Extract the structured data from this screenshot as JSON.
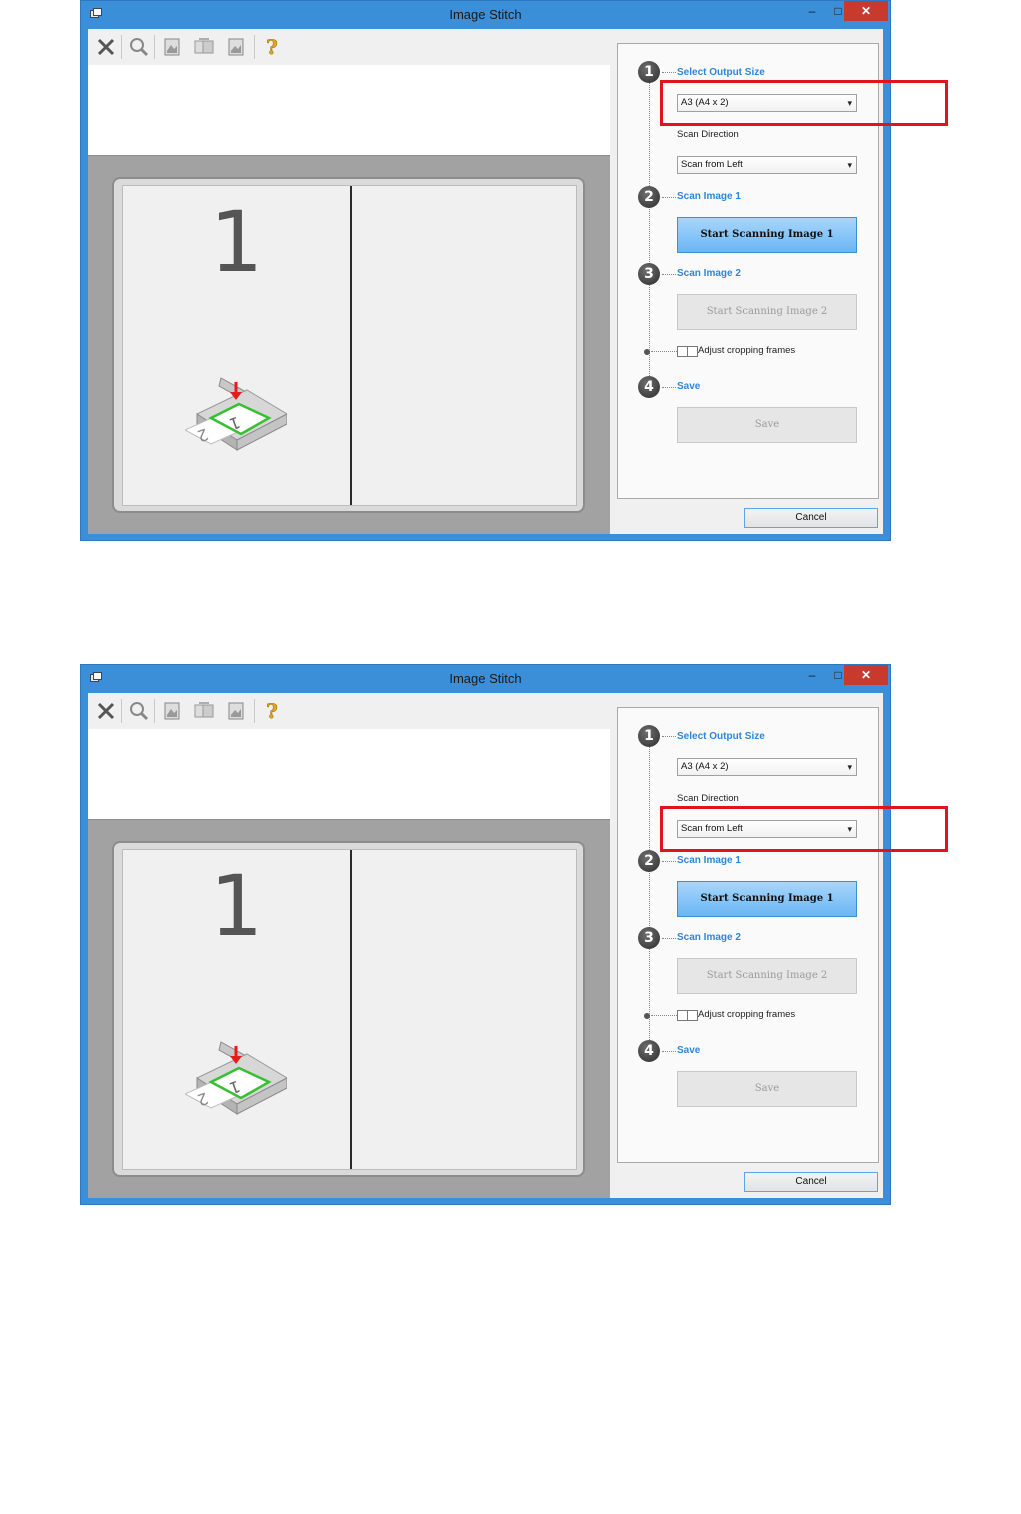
{
  "screens": [
    {
      "title": "Image Stitch",
      "window_buttons": {
        "minimize": "–",
        "maximize": "□",
        "close": "✕"
      },
      "toolbar": [
        "close-icon",
        "zoom-icon",
        "image1-icon",
        "swap-icon",
        "image2-icon",
        "help-icon"
      ],
      "preview_number": "1",
      "step1": {
        "label": "Select Output Size",
        "number": "1",
        "output_size": "A3 (A4 x 2)"
      },
      "scan_direction": {
        "label": "Scan Direction",
        "value": "Scan from Left"
      },
      "step2": {
        "label": "Scan Image 1",
        "number": "2",
        "button": "Start Scanning Image 1"
      },
      "step3": {
        "label": "Scan Image 2",
        "number": "3",
        "button": "Start Scanning Image 2"
      },
      "adjust": {
        "label": "Adjust cropping frames",
        "checked": false
      },
      "step4": {
        "label": "Save",
        "number": "4",
        "button": "Save"
      },
      "cancel": "Cancel",
      "highlighted": "output-size-select"
    },
    {
      "title": "Image Stitch",
      "window_buttons": {
        "minimize": "–",
        "maximize": "□",
        "close": "✕"
      },
      "toolbar": [
        "close-icon",
        "zoom-icon",
        "image1-icon",
        "swap-icon",
        "image2-icon",
        "help-icon"
      ],
      "preview_number": "1",
      "step1": {
        "label": "Select Output Size",
        "number": "1",
        "output_size": "A3 (A4 x 2)"
      },
      "scan_direction": {
        "label": "Scan Direction",
        "value": "Scan from Left"
      },
      "step2": {
        "label": "Scan Image 1",
        "number": "2",
        "button": "Start Scanning Image 1"
      },
      "step3": {
        "label": "Scan Image 2",
        "number": "3",
        "button": "Start Scanning Image 2"
      },
      "adjust": {
        "label": "Adjust cropping frames",
        "checked": false
      },
      "step4": {
        "label": "Save",
        "number": "4",
        "button": "Save"
      },
      "cancel": "Cancel",
      "highlighted": "scan-direction-select"
    }
  ],
  "colors": {
    "highlight": "#e0141e",
    "step_label": "#2f86d8",
    "primary_button": "#6ab6f4",
    "title_bar": "#3a8fd8",
    "close_button": "#c83a2c"
  }
}
